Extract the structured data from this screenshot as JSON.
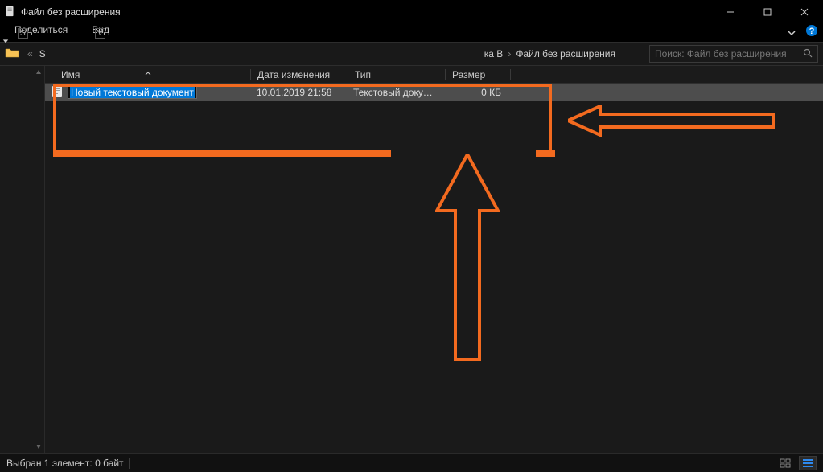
{
  "window": {
    "title": "Файл без расширения"
  },
  "ribbon": {
    "share": "Поделиться",
    "share_key": "S",
    "view": "Вид",
    "view_key": "V"
  },
  "breadcrumb": {
    "chevrons": "«",
    "seg1_partial": "S",
    "seg2_partial": "ка B",
    "seg3": "Файл без расширения"
  },
  "search": {
    "placeholder": "Поиск: Файл без расширения"
  },
  "columns": {
    "name": "Имя",
    "date": "Дата изменения",
    "type": "Тип",
    "size": "Размер"
  },
  "file": {
    "name": "Новый текстовый документ",
    "date": "10.01.2019 21:58",
    "type": "Текстовый докум...",
    "size": "0 КБ"
  },
  "statusbar": {
    "text": "Выбран 1 элемент: 0 байт"
  },
  "annotation_color": "#f36a1f"
}
